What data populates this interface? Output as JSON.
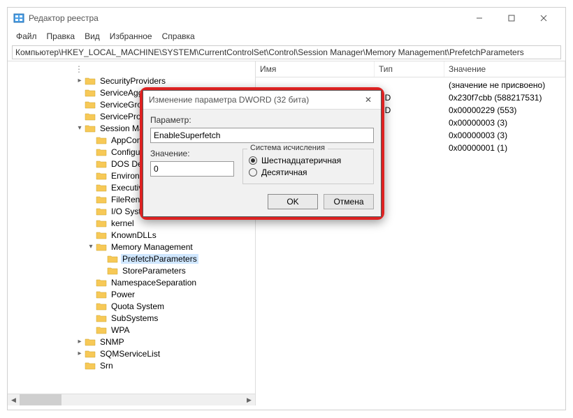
{
  "window": {
    "title": "Редактор реестра",
    "menu": [
      "Файл",
      "Правка",
      "Вид",
      "Избранное",
      "Справка"
    ],
    "path": "Компьютер\\HKEY_LOCAL_MACHINE\\SYSTEM\\CurrentControlSet\\Control\\Session Manager\\Memory Management\\PrefetchParameters"
  },
  "tree": {
    "items": [
      {
        "indent": 96,
        "twisty": ">",
        "label": "SecurityProviders"
      },
      {
        "indent": 96,
        "twisty": "",
        "label": "ServiceAggregatedEvents"
      },
      {
        "indent": 96,
        "twisty": "",
        "label": "ServiceGroupOrder"
      },
      {
        "indent": 96,
        "twisty": "",
        "label": "ServiceProvider"
      },
      {
        "indent": 96,
        "twisty": "v",
        "label": "Session Manager"
      },
      {
        "indent": 112,
        "twisty": "",
        "label": "AppCompatCache"
      },
      {
        "indent": 112,
        "twisty": "",
        "label": "Configuration Manager"
      },
      {
        "indent": 112,
        "twisty": "",
        "label": "DOS Devices"
      },
      {
        "indent": 112,
        "twisty": "",
        "label": "Environment"
      },
      {
        "indent": 112,
        "twisty": "",
        "label": "Executive"
      },
      {
        "indent": 112,
        "twisty": "",
        "label": "FileRenameOperations"
      },
      {
        "indent": 112,
        "twisty": "",
        "label": "I/O System"
      },
      {
        "indent": 112,
        "twisty": "",
        "label": "kernel"
      },
      {
        "indent": 112,
        "twisty": "",
        "label": "KnownDLLs"
      },
      {
        "indent": 112,
        "twisty": "v",
        "label": "Memory Management"
      },
      {
        "indent": 128,
        "twisty": "",
        "label": "PrefetchParameters",
        "selected": true
      },
      {
        "indent": 128,
        "twisty": "",
        "label": "StoreParameters"
      },
      {
        "indent": 112,
        "twisty": "",
        "label": "NamespaceSeparation"
      },
      {
        "indent": 112,
        "twisty": "",
        "label": "Power"
      },
      {
        "indent": 112,
        "twisty": "",
        "label": "Quota System"
      },
      {
        "indent": 112,
        "twisty": "",
        "label": "SubSystems"
      },
      {
        "indent": 112,
        "twisty": "",
        "label": "WPA"
      },
      {
        "indent": 96,
        "twisty": ">",
        "label": "SNMP"
      },
      {
        "indent": 96,
        "twisty": ">",
        "label": "SQMServiceList"
      },
      {
        "indent": 96,
        "twisty": "",
        "label": "Srn"
      }
    ]
  },
  "list": {
    "headers": {
      "name": "Имя",
      "type": "Тип",
      "value": "Значение"
    },
    "rows": [
      {
        "name": "",
        "type": "",
        "value": "(значение не присвоено)"
      },
      {
        "name": "",
        "type": "RD",
        "value": "0x230f7cbb (588217531)"
      },
      {
        "name": "",
        "type": "RD",
        "value": "0x00000229 (553)"
      },
      {
        "name": "",
        "type": "",
        "value": "0x00000003 (3)"
      },
      {
        "name": "",
        "type": "",
        "value": "0x00000003 (3)"
      },
      {
        "name": "",
        "type": "",
        "value": "0x00000001 (1)"
      }
    ]
  },
  "dialog": {
    "title": "Изменение параметра DWORD (32 бита)",
    "param_label": "Параметр:",
    "param_value": "EnableSuperfetch",
    "value_label": "Значение:",
    "value_value": "0",
    "group_label": "Система исчисления",
    "radio_hex": "Шестнадцатеричная",
    "radio_dec": "Десятичная",
    "ok": "OK",
    "cancel": "Отмена"
  }
}
